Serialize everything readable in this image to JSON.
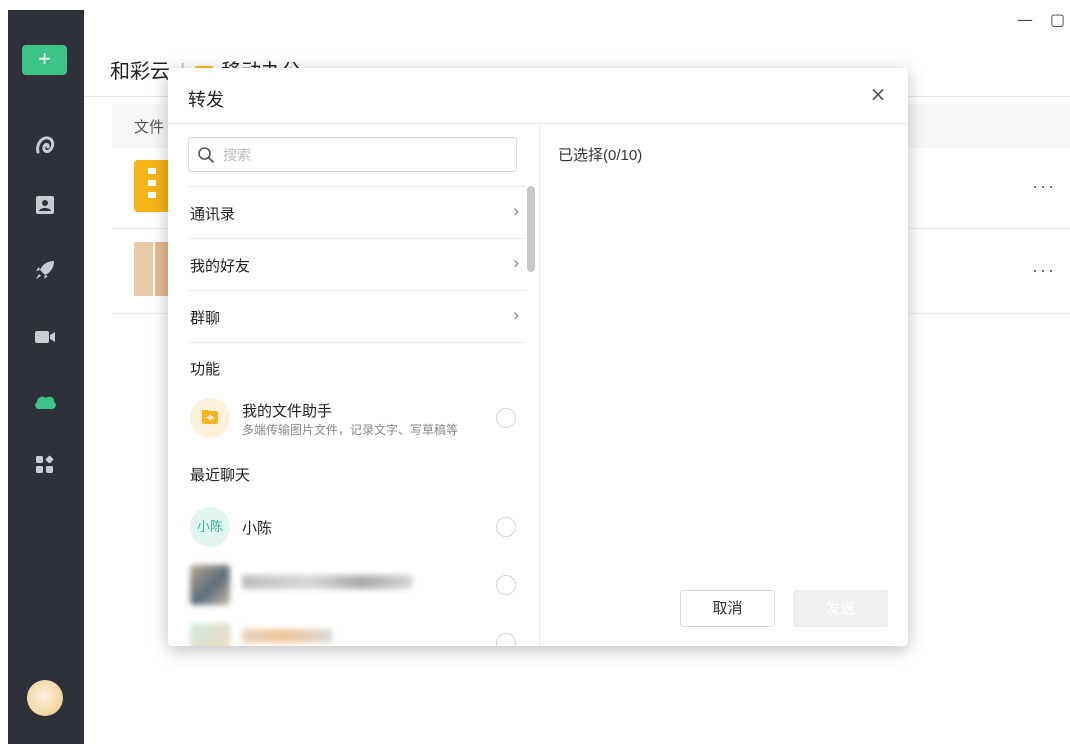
{
  "window": {
    "minimize_glyph": "—",
    "maximize_glyph": "▢"
  },
  "sidebar": {
    "add_label": "+",
    "icons": [
      "album-icon",
      "contact-card-icon",
      "rocket-icon",
      "video-icon",
      "cloud-icon",
      "apps-icon"
    ]
  },
  "main": {
    "app_name": "和彩云",
    "folder_name": "移动办公",
    "column_header": "文件",
    "more_glyph": "···"
  },
  "dialog": {
    "title": "转发",
    "close_glyph": "×",
    "search": {
      "placeholder": "搜索",
      "value": ""
    },
    "nav_items": [
      {
        "label": "通讯录",
        "chevron": "›"
      },
      {
        "label": "我的好友",
        "chevron": "›"
      },
      {
        "label": "群聊",
        "chevron": "›"
      }
    ],
    "section_function": "功能",
    "file_assistant": {
      "name": "我的文件助手",
      "desc": "多端传输图片文件，记录文字、写草稿等"
    },
    "section_recent": "最近聊天",
    "recent": [
      {
        "avatar_text": "小陈",
        "name": "小陈"
      }
    ],
    "selected_label": "已选择(0/10)",
    "cancel_label": "取消",
    "send_label": "发送"
  },
  "colors": {
    "accent": "#3ec38b",
    "sidebar_bg": "#2e3238",
    "folder": "#f5b622"
  }
}
